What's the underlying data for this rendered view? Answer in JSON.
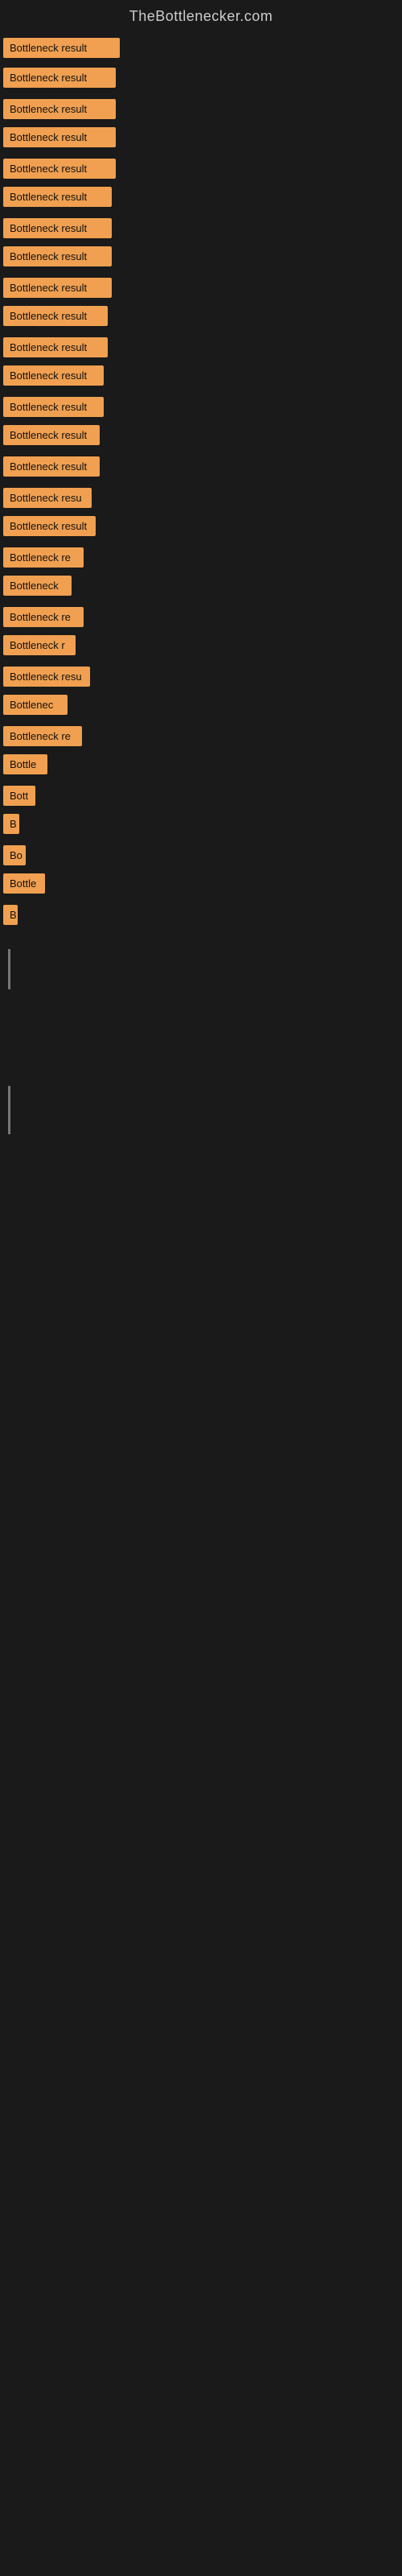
{
  "site": {
    "title": "TheBottlenecker.com"
  },
  "items": [
    {
      "id": 1,
      "label": "Bottleneck result",
      "width": 145,
      "marginTop": 8
    },
    {
      "id": 2,
      "label": "Bottleneck result",
      "width": 140,
      "marginTop": 12
    },
    {
      "id": 3,
      "label": "Bottleneck result",
      "width": 140,
      "marginTop": 14
    },
    {
      "id": 4,
      "label": "Bottleneck result",
      "width": 140,
      "marginTop": 10
    },
    {
      "id": 5,
      "label": "Bottleneck result",
      "width": 140,
      "marginTop": 14
    },
    {
      "id": 6,
      "label": "Bottleneck result",
      "width": 135,
      "marginTop": 10
    },
    {
      "id": 7,
      "label": "Bottleneck result",
      "width": 135,
      "marginTop": 14
    },
    {
      "id": 8,
      "label": "Bottleneck result",
      "width": 135,
      "marginTop": 10
    },
    {
      "id": 9,
      "label": "Bottleneck result",
      "width": 135,
      "marginTop": 14
    },
    {
      "id": 10,
      "label": "Bottleneck result",
      "width": 130,
      "marginTop": 10
    },
    {
      "id": 11,
      "label": "Bottleneck result",
      "width": 130,
      "marginTop": 14
    },
    {
      "id": 12,
      "label": "Bottleneck result",
      "width": 125,
      "marginTop": 10
    },
    {
      "id": 13,
      "label": "Bottleneck result",
      "width": 125,
      "marginTop": 14
    },
    {
      "id": 14,
      "label": "Bottleneck result",
      "width": 120,
      "marginTop": 10
    },
    {
      "id": 15,
      "label": "Bottleneck result",
      "width": 120,
      "marginTop": 14
    },
    {
      "id": 16,
      "label": "Bottleneck resu",
      "width": 110,
      "marginTop": 14
    },
    {
      "id": 17,
      "label": "Bottleneck result",
      "width": 115,
      "marginTop": 10
    },
    {
      "id": 18,
      "label": "Bottleneck re",
      "width": 100,
      "marginTop": 14
    },
    {
      "id": 19,
      "label": "Bottleneck",
      "width": 85,
      "marginTop": 10
    },
    {
      "id": 20,
      "label": "Bottleneck re",
      "width": 100,
      "marginTop": 14
    },
    {
      "id": 21,
      "label": "Bottleneck r",
      "width": 90,
      "marginTop": 10
    },
    {
      "id": 22,
      "label": "Bottleneck resu",
      "width": 108,
      "marginTop": 14
    },
    {
      "id": 23,
      "label": "Bottlenec",
      "width": 80,
      "marginTop": 10
    },
    {
      "id": 24,
      "label": "Bottleneck re",
      "width": 98,
      "marginTop": 14
    },
    {
      "id": 25,
      "label": "Bottle",
      "width": 55,
      "marginTop": 10
    },
    {
      "id": 26,
      "label": "Bott",
      "width": 40,
      "marginTop": 14
    },
    {
      "id": 27,
      "label": "B",
      "width": 20,
      "marginTop": 10
    },
    {
      "id": 28,
      "label": "Bo",
      "width": 28,
      "marginTop": 14
    },
    {
      "id": 29,
      "label": "Bottle",
      "width": 52,
      "marginTop": 10
    },
    {
      "id": 30,
      "label": "B",
      "width": 18,
      "marginTop": 14
    }
  ]
}
